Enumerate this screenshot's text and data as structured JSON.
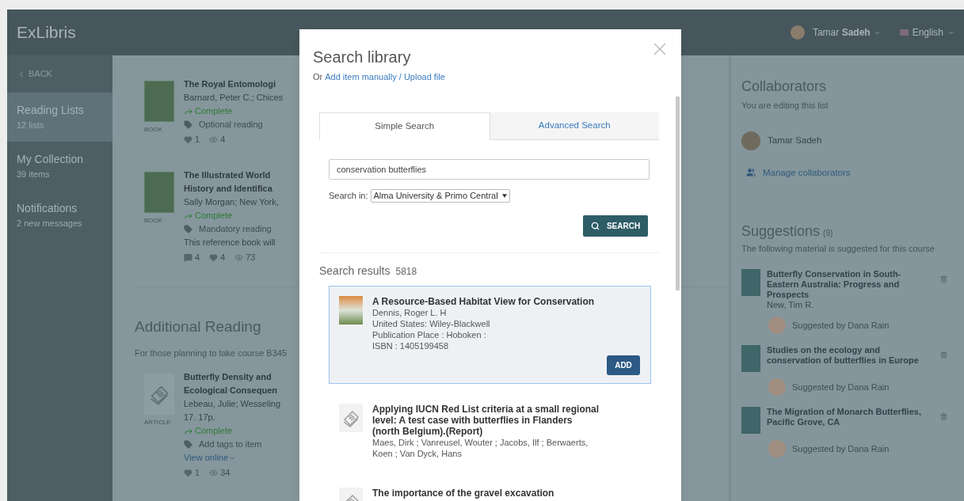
{
  "header": {
    "logo": "ExLibris",
    "user": "Tamar **Sadeh**",
    "language": "English"
  },
  "sidebar": {
    "back": "BACK",
    "items": [
      {
        "title": "Reading Lists",
        "subtitle": "12 lists",
        "selected": true
      },
      {
        "title": "My Collection",
        "subtitle": "39 items",
        "selected": false
      },
      {
        "title": "Notifications",
        "subtitle": "2 new messages",
        "selected": false
      }
    ]
  },
  "main": {
    "blocks": [
      {
        "kind": "book",
        "type_label": "BOOK",
        "title_lines": [
          "The Royal Entomologi"
        ],
        "meta": [
          "Barnard, Peter C.; Chices"
        ],
        "status": "Complete",
        "tag": "Optional reading",
        "stats": [
          {
            "kind": "likes",
            "count": "1"
          },
          {
            "kind": "views",
            "count": "4"
          }
        ]
      },
      {
        "kind": "book",
        "type_label": "BOOK",
        "title_lines": [
          "The Illustrated World",
          "History and Identifica"
        ],
        "meta": [
          "Sally Morgan; New York,"
        ],
        "status": "Complete",
        "tag": "Mandatory reading",
        "note": "This reference book will",
        "stats": [
          {
            "kind": "comments",
            "count": "4"
          },
          {
            "kind": "likes",
            "count": "4"
          },
          {
            "kind": "views",
            "count": "73"
          }
        ]
      },
      {
        "kind": "section",
        "heading": "Additional Reading",
        "description": "For those planning to take course B345"
      },
      {
        "kind": "article",
        "type_label": "ARTICLE",
        "title_lines": [
          "Butterfly Density and",
          "Ecological Consequen"
        ],
        "meta": [
          "Lebeau, Julie; Wesseling",
          "17. 17p."
        ],
        "status": "Complete",
        "tag": "Add tags to item",
        "link": "View online",
        "stats": [
          {
            "kind": "likes",
            "count": "1"
          },
          {
            "kind": "views",
            "count": "34"
          }
        ]
      }
    ]
  },
  "modal": {
    "title": "Search library",
    "prefix": "Or",
    "link": "Add item manually / Upload file",
    "tabs": [
      {
        "label": "Simple Search",
        "selected": true
      },
      {
        "label": "Advanced Search",
        "selected": false
      }
    ],
    "query": "conservation butterflies",
    "search_in_label": "Search in:",
    "search_in": "Alma University & Primo Central",
    "search_button": "SEARCH",
    "results_heading": "Search results",
    "results_count": "5818",
    "results": [
      {
        "kind": "book",
        "title": "A Resource-Based Habitat View for Conservation",
        "lines": [
          "Dennis, Roger L. H",
          "United States: Wiley-Blackwell",
          "Publication Place : Hoboken :",
          "ISBN : 1405199458"
        ],
        "selected": true,
        "button": "ADD"
      },
      {
        "kind": "article",
        "title": "Applying IUCN Red List criteria at a small regional level: A test case with butterflies in Flanders (north Belgium).(Report)",
        "lines": [
          "Maes, Dirk ; Vanreusel, Wouter ; Jacobs, Ilf ; Berwaerts, Koen ; Van Dyck, Hans"
        ],
        "selected": false
      },
      {
        "kind": "article",
        "title": "The importance of the gravel excavation",
        "selected": false
      }
    ]
  },
  "collaborators": {
    "heading": "Collaborators",
    "subtitle": "You are editing this list",
    "person": "Tamar Sadeh",
    "manage": "Manage collaborators"
  },
  "suggestions": {
    "heading": "Suggestions",
    "count": "(9)",
    "description": "The following material is suggested for this course",
    "items": [
      {
        "title": "Butterfly Conservation in South-Eastern Australia: Progress and Prospects",
        "author": "New, Tim R.",
        "suggested_by": "Suggested by Dana Rain"
      },
      {
        "title": "Studies on the ecology and conservation of butterflies in Europe",
        "suggested_by": "Suggested by Dana Rain"
      },
      {
        "title": "The Migration of Monarch Butterflies, Pacific Grove, CA",
        "suggested_by": "Suggested by Dana Rain"
      }
    ]
  }
}
